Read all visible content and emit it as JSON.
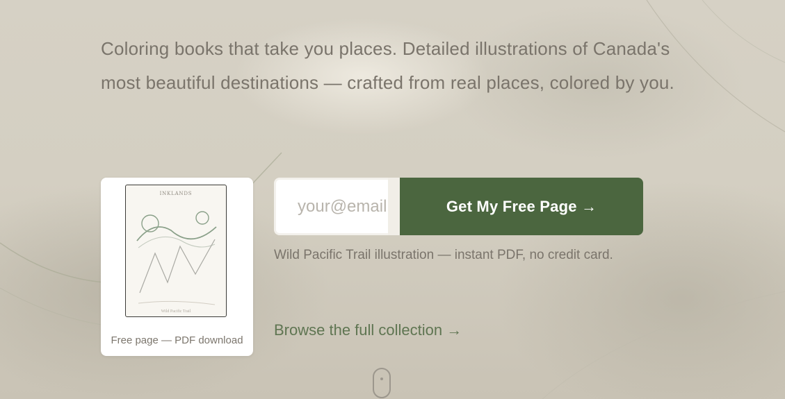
{
  "hero": {
    "tagline": "Coloring books that take you places. Detailed illustrations of Canada's most beautiful destinations — crafted from real places, colored by you."
  },
  "preview_card": {
    "brand": "INKLANDS",
    "page_caption": "Wild Pacific Trail",
    "label": "Free page — PDF download"
  },
  "signup": {
    "email_placeholder": "your@email.com",
    "email_value": "",
    "button_label": "Get My Free Page →",
    "note": "Wild Pacific Trail illustration — instant PDF, no credit card."
  },
  "links": {
    "browse": "Browse the full collection →"
  },
  "colors": {
    "accent": "#4b663f",
    "link": "#5f7552",
    "text_muted": "#7a746b"
  },
  "icons": {
    "scroll": "mouse-scroll-icon"
  }
}
